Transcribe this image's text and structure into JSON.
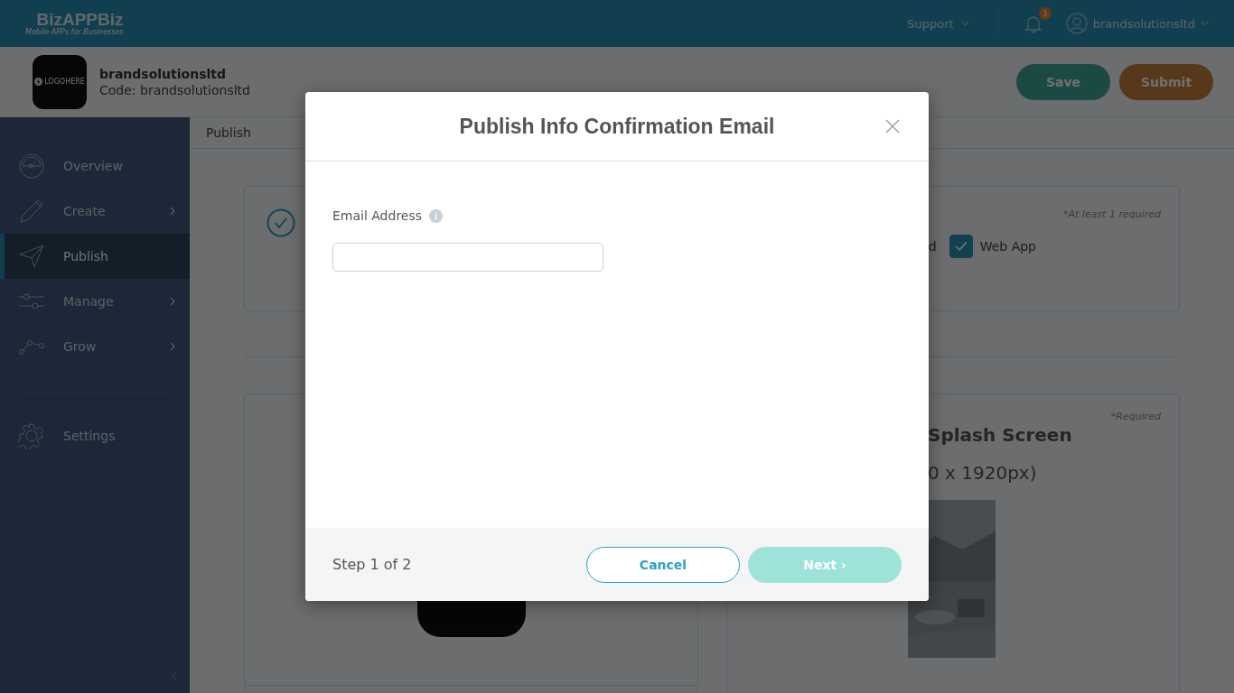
{
  "topbar": {
    "logo": "BizAPPBiz",
    "tagline": "Mobile APPs for Businesses",
    "support": "Support",
    "notification_count": "3",
    "user": "brandsolutionsltd"
  },
  "account": {
    "logo_text": "LOGOHERE",
    "name": "brandsolutionsltd",
    "code": "Code: brandsolutionsltd",
    "buttons": [
      {
        "label": "Save",
        "kind": "save"
      },
      {
        "label": "Submit",
        "kind": "submit"
      }
    ]
  },
  "sidebar": {
    "items": [
      {
        "label": "Overview",
        "kind": "gauge",
        "has_submenu": false,
        "selected": false
      },
      {
        "label": "Create",
        "kind": "pencil",
        "has_submenu": true,
        "selected": false
      },
      {
        "label": "Publish",
        "kind": "plane",
        "has_submenu": false,
        "selected": true
      },
      {
        "label": "Manage",
        "kind": "sliders",
        "has_submenu": true,
        "selected": false
      },
      {
        "label": "Grow",
        "kind": "nodes",
        "has_submenu": true,
        "selected": false
      }
    ],
    "bottom_items": [
      {
        "label": "Settings",
        "kind": "gear",
        "selected": false
      }
    ]
  },
  "breadcrumb": "Publish",
  "platforms_card": {
    "note": "*At least 1 required",
    "hidden_label_fragment": "d",
    "platforms": [
      {
        "label": "Web App",
        "checked": true
      }
    ]
  },
  "splash_card": {
    "note": "*Required",
    "title": "Splash Screen",
    "size": "0 x 1920px)"
  },
  "modal": {
    "title": "Publish Info Confirmation Email",
    "field_label": "Email Address",
    "step": "Step 1 of 2",
    "cancel": "Cancel",
    "next": {
      "label": "Next ›",
      "disabled": true
    }
  }
}
